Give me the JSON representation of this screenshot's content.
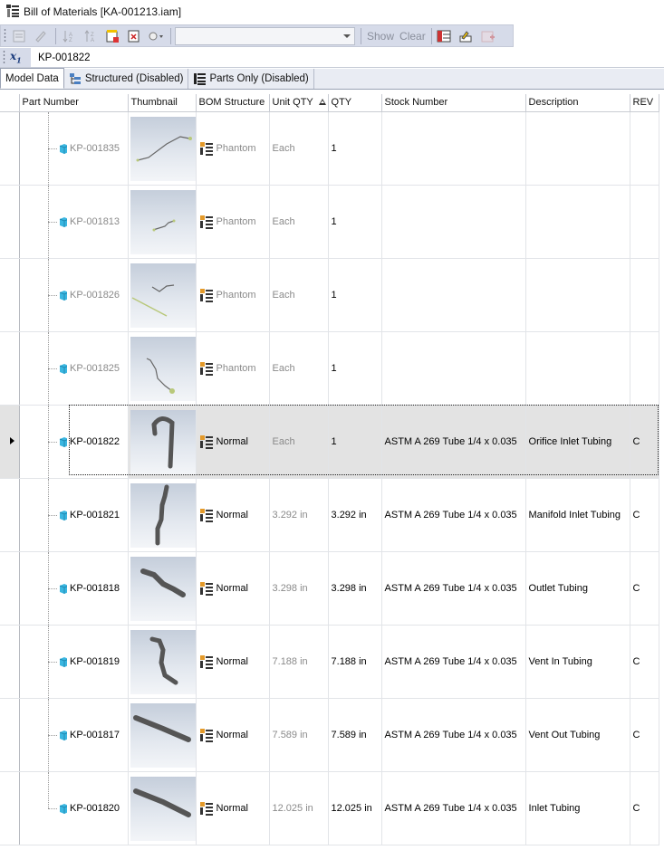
{
  "window": {
    "title": "Bill of Materials [KA-001213.iam]"
  },
  "toolbar": {
    "search_value": "",
    "show_label": "Show",
    "clear_label": "Clear"
  },
  "formula_bar": {
    "value": "KP-001822"
  },
  "tabs": [
    {
      "label": "Model Data"
    },
    {
      "label": "Structured (Disabled)"
    },
    {
      "label": "Parts Only (Disabled)"
    }
  ],
  "columns": [
    "Part Number",
    "Thumbnail",
    "BOM Structure",
    "Unit QTY",
    "QTY",
    "Stock Number",
    "Description",
    "REV"
  ],
  "rows": [
    {
      "part_number": "KP-001835",
      "bom_structure": "Phantom",
      "unit_qty": "Each",
      "qty": "1",
      "stock_number": "",
      "description": "",
      "rev": ""
    },
    {
      "part_number": "KP-001813",
      "bom_structure": "Phantom",
      "unit_qty": "Each",
      "qty": "1",
      "stock_number": "",
      "description": "",
      "rev": ""
    },
    {
      "part_number": "KP-001826",
      "bom_structure": "Phantom",
      "unit_qty": "Each",
      "qty": "1",
      "stock_number": "",
      "description": "",
      "rev": ""
    },
    {
      "part_number": "KP-001825",
      "bom_structure": "Phantom",
      "unit_qty": "Each",
      "qty": "1",
      "stock_number": "",
      "description": "",
      "rev": ""
    },
    {
      "part_number": "KP-001822",
      "bom_structure": "Normal",
      "unit_qty": "Each",
      "qty": "1",
      "stock_number": "ASTM A 269 Tube 1/4 x 0.035",
      "description": "Orifice Inlet Tubing",
      "rev": "C"
    },
    {
      "part_number": "KP-001821",
      "bom_structure": "Normal",
      "unit_qty": "3.292 in",
      "qty": "3.292 in",
      "stock_number": "ASTM A 269 Tube 1/4 x 0.035",
      "description": "Manifold Inlet Tubing",
      "rev": "C"
    },
    {
      "part_number": "KP-001818",
      "bom_structure": "Normal",
      "unit_qty": "3.298 in",
      "qty": "3.298 in",
      "stock_number": "ASTM A 269 Tube 1/4 x 0.035",
      "description": "Outlet Tubing",
      "rev": "C"
    },
    {
      "part_number": "KP-001819",
      "bom_structure": "Normal",
      "unit_qty": "7.188 in",
      "qty": "7.188 in",
      "stock_number": "ASTM A 269 Tube 1/4 x 0.035",
      "description": "Vent In Tubing",
      "rev": "C"
    },
    {
      "part_number": "KP-001817",
      "bom_structure": "Normal",
      "unit_qty": "7.589 in",
      "qty": "7.589 in",
      "stock_number": "ASTM A 269 Tube 1/4 x 0.035",
      "description": "Vent Out Tubing",
      "rev": "C"
    },
    {
      "part_number": "KP-001820",
      "bom_structure": "Normal",
      "unit_qty": "12.025 in",
      "qty": "12.025 in",
      "stock_number": "ASTM A 269 Tube 1/4 x 0.035",
      "description": "Inlet Tubing",
      "rev": "C"
    }
  ],
  "colors": {
    "toolbar_bg": "#d6dbe9",
    "selected_row": "#e3e3e3",
    "part_icon": "#3ab6e0"
  }
}
